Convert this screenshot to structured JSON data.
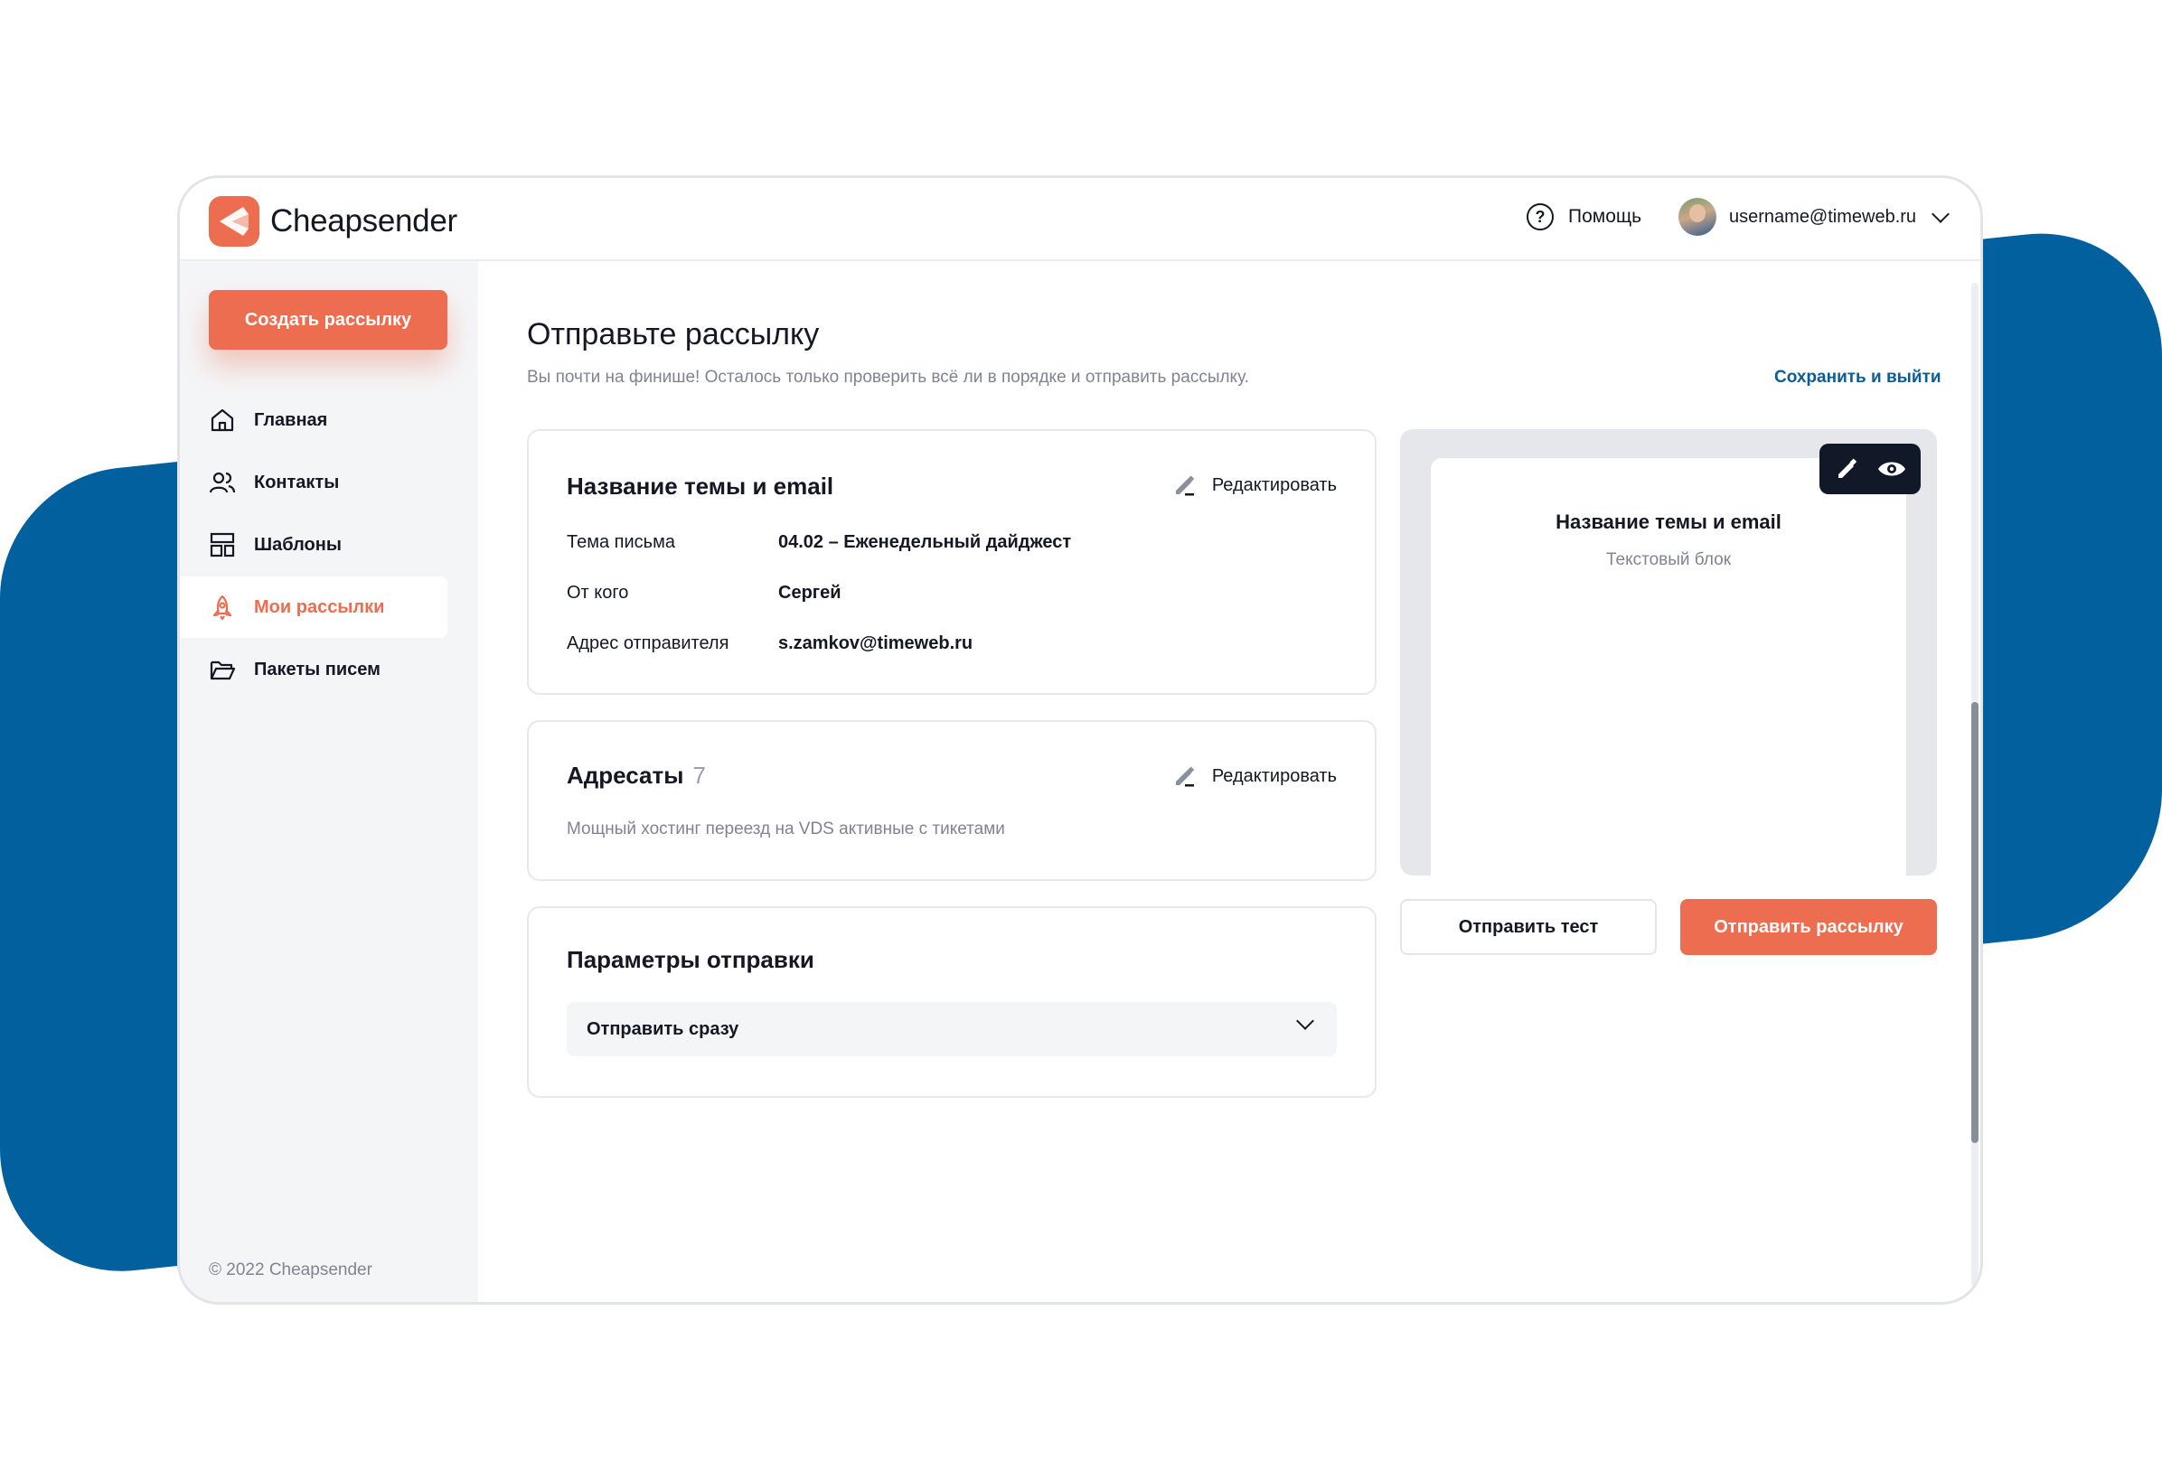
{
  "app": {
    "name": "Cheapsender",
    "accent": "#ec6d4f",
    "link_color": "#0a5d99",
    "background_blob_color": "#03609e"
  },
  "header": {
    "help_label": "Помощь",
    "user_email": "username@timeweb.ru"
  },
  "sidebar": {
    "create_button": "Создать рассылку",
    "items": [
      {
        "label": "Главная",
        "icon": "home-icon",
        "active": false
      },
      {
        "label": "Контакты",
        "icon": "contacts-icon",
        "active": false
      },
      {
        "label": "Шаблоны",
        "icon": "templates-icon",
        "active": false
      },
      {
        "label": "Мои рассылки",
        "icon": "rocket-icon",
        "active": true
      },
      {
        "label": "Пакеты писем",
        "icon": "folder-icon",
        "active": false
      }
    ],
    "copyright": "© 2022 Cheapsender"
  },
  "main": {
    "title": "Отправьте рассылку",
    "subtitle": "Вы почти на финише! Осталось только проверить всё ли в порядке и отправить рассылку.",
    "save_exit": "Сохранить и выйти",
    "subject_card": {
      "title": "Название темы и email",
      "edit_label": "Редактировать",
      "rows": [
        {
          "label": "Тема письма",
          "value": "04.02 – Еженедельный дайджест"
        },
        {
          "label": "От кого",
          "value": "Сергей"
        },
        {
          "label": "Адрес отправителя",
          "value": "s.zamkov@timeweb.ru"
        }
      ]
    },
    "recipients_card": {
      "title": "Адресаты",
      "count": "7",
      "edit_label": "Редактировать",
      "description": "Мощный хостинг переезд  на VDS активные с тикетами"
    },
    "params_card": {
      "title": "Параметры отправки",
      "select_value": "Отправить сразу"
    },
    "preview": {
      "title": "Название темы и email",
      "text": "Текстовый блок"
    },
    "send_test": "Отправить тест",
    "send": "Отправить рассылку"
  }
}
